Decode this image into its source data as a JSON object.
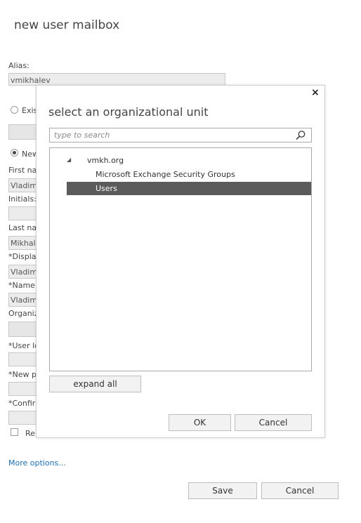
{
  "page": {
    "title": "new user mailbox"
  },
  "form": {
    "alias_label": "Alias:",
    "alias_value": "vmikhalev",
    "existing_user_label": "Exis",
    "new_user_label": "New",
    "first_name_label": "First na",
    "first_name_value": "Vladim",
    "initials_label": "Initials:",
    "last_name_label": "Last nal",
    "last_name_value": "Mikhal",
    "display_name_label": "*Display",
    "display_name_value": "Vladim",
    "name_label": "*Name:",
    "name_value": "Vladim",
    "org_unit_label": "Organiz",
    "user_logon_label": "*User lo",
    "new_password_label": "*New p",
    "confirm_password_label": "*Confir",
    "require_change_label": "Re",
    "more_options_link": "More options...",
    "save_label": "Save",
    "cancel_label": "Cancel"
  },
  "dialog": {
    "title": "select an organizational unit",
    "close_glyph": "×",
    "search_placeholder": "type to search",
    "tree": {
      "root": "vmkh.org",
      "children": [
        "Microsoft Exchange Security Groups",
        "Users"
      ],
      "selected": "Users"
    },
    "expand_all_label": "expand all",
    "ok_label": "OK",
    "cancel_label": "Cancel"
  },
  "colors": {
    "selection": "#5b5b5b",
    "link": "#1f6fb2",
    "field_bg": "#ececec"
  }
}
